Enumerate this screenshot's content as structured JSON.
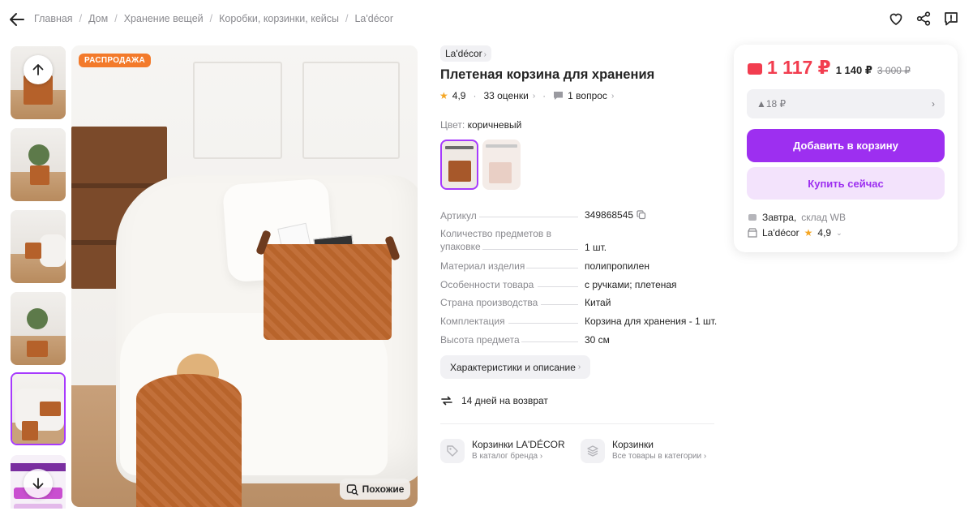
{
  "breadcrumbs": [
    "Главная",
    "Дом",
    "Хранение вещей",
    "Коробки, корзинки, кейсы",
    "La'décor"
  ],
  "icons": {
    "back": "arrow-left-icon",
    "favorite": "heart-icon",
    "share": "share-icon",
    "report": "report-icon",
    "thumb_up": "arrow-up-icon",
    "thumb_down": "arrow-down-icon",
    "similar": "image-search-icon",
    "copy": "copy-icon",
    "return": "return-arrows-icon",
    "brand_catalog": "tag-icon",
    "category": "stack-icon",
    "wallet": "wallet-icon",
    "warehouse": "warehouse-icon",
    "store": "store-icon"
  },
  "gallery": {
    "sale_badge": "РАСПРОДАЖА",
    "similar_label": "Похожие"
  },
  "product": {
    "brand": "La'décor",
    "title": "Плетеная корзина для хранения",
    "rating": "4,9",
    "reviews": "33 оценки",
    "questions": "1 вопрос",
    "color_label": "Цвет:",
    "color_value": "коричневый"
  },
  "specs": [
    {
      "k": "Артикул",
      "v": "349868545"
    },
    {
      "k": "Количество предметов в упаковке",
      "v": "1 шт."
    },
    {
      "k": "Материал изделия",
      "v": "полипропилен"
    },
    {
      "k": "Особенности товара",
      "v": "с ручками; плетеная"
    },
    {
      "k": "Страна производства",
      "v": "Китай"
    },
    {
      "k": "Комплектация",
      "v": "Корзина для хранения - 1 шт."
    },
    {
      "k": "Высота предмета",
      "v": "30 см"
    }
  ],
  "details_button": "Характеристики и описание",
  "return_policy": "14 дней на возврат",
  "links": {
    "brand_title": "Корзинки LA'DÉCOR",
    "brand_sub": "В каталог бренда",
    "category_title": "Корзинки",
    "category_sub": "Все товары в категории"
  },
  "buybox": {
    "price": "1 117 ₽",
    "price_alt": "1 140 ₽",
    "price_old": "3 000 ₽",
    "installment": "▲18 ₽",
    "add_to_cart": "Добавить в корзину",
    "buy_now": "Купить сейчас",
    "delivery_day": "Завтра,",
    "delivery_source": "склад WB",
    "seller": "La'décor",
    "seller_rating": "4,9"
  },
  "colors": {
    "accent": "#9d2ff0",
    "price": "#f23d4f",
    "sale_badge": "#f37a2b",
    "star": "#f5a623"
  }
}
